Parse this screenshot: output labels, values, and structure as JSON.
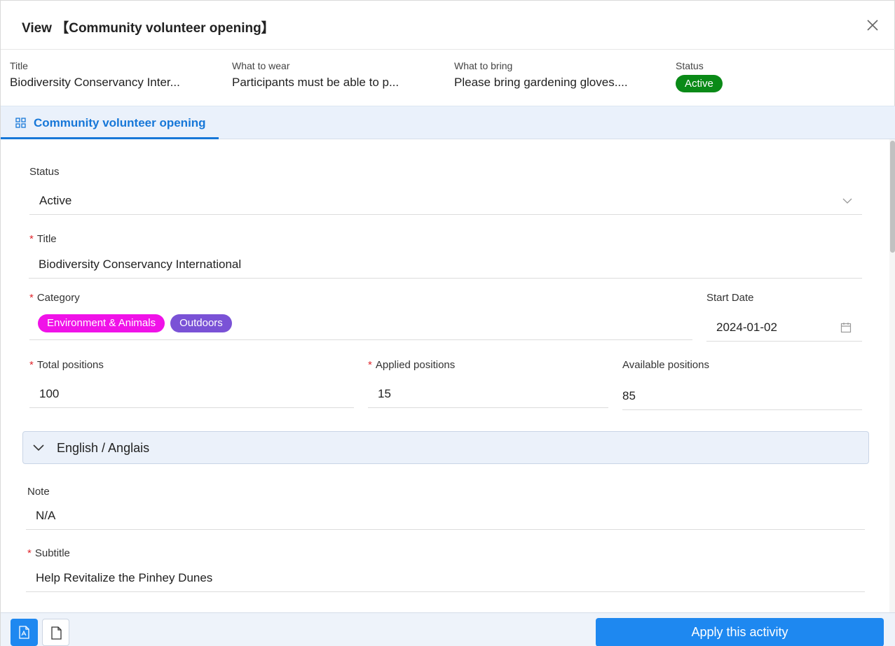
{
  "dialog": {
    "title": "View 【Community volunteer opening】"
  },
  "summary": {
    "title_label": "Title",
    "title_value": "Biodiversity Conservancy Inter...",
    "wear_label": "What to wear",
    "wear_value": "Participants must be able to p...",
    "bring_label": "What to bring",
    "bring_value": "Please bring gardening gloves....",
    "status_label": "Status",
    "status_value": "Active",
    "status_color": "#0a8a17"
  },
  "tab": {
    "label": "Community volunteer opening",
    "icon": "grid-icon"
  },
  "form": {
    "status_label": "Status",
    "status_value": "Active",
    "title_label": "Title",
    "title_value": "Biodiversity Conservancy International",
    "category_label": "Category",
    "categories": [
      {
        "label": "Environment & Animals",
        "color": "#f012e8"
      },
      {
        "label": "Outdoors",
        "color": "#7a52d6"
      }
    ],
    "start_date_label": "Start Date",
    "start_date_value": "2024-01-02",
    "total_label": "Total positions",
    "total_value": "100",
    "applied_label": "Applied positions",
    "applied_value": "15",
    "available_label": "Available positions",
    "available_value": "85",
    "required_marker": "*"
  },
  "language_section": {
    "label": "English / Anglais"
  },
  "lang_form": {
    "note_label": "Note",
    "note_value": "N/A",
    "subtitle_label": "Subtitle",
    "subtitle_value": "Help Revitalize the Pinhey Dunes"
  },
  "footer": {
    "apply_label": "Apply this activity",
    "pdf_icon": "pdf-file-icon",
    "doc_icon": "document-icon",
    "accent_color": "#1e88f0"
  }
}
